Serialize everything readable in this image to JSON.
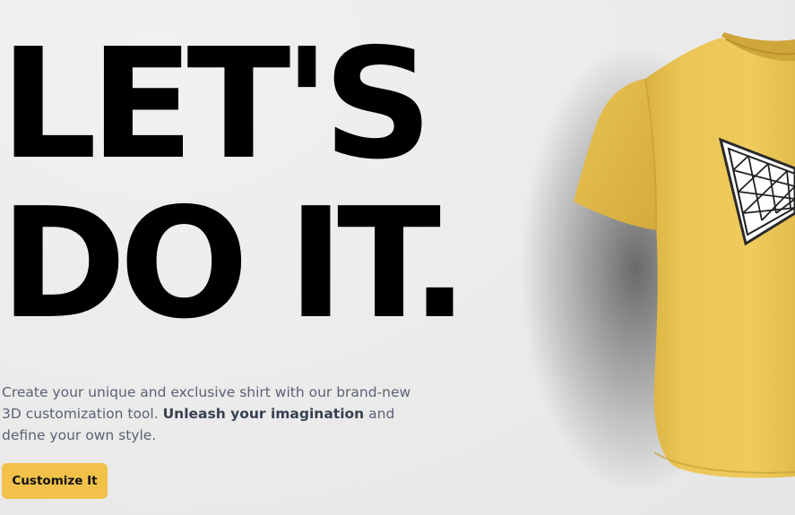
{
  "hero": {
    "headline_line1": "LET'S",
    "headline_line2": "DO IT.",
    "tagline_start": "Create your unique and exclusive shirt with our brand-new 3D customization tool.",
    "tagline_bold": "Unleash your imagination",
    "tagline_end": "and define your own style."
  },
  "cta": {
    "label": "Customize It"
  },
  "shirt": {
    "color": "#e8c351",
    "icon": "triangle-grid-logo-icon"
  },
  "colors": {
    "background": "#ebebeb",
    "accent": "#f2c14a",
    "text": "#000000",
    "muted": "#5a6272"
  }
}
